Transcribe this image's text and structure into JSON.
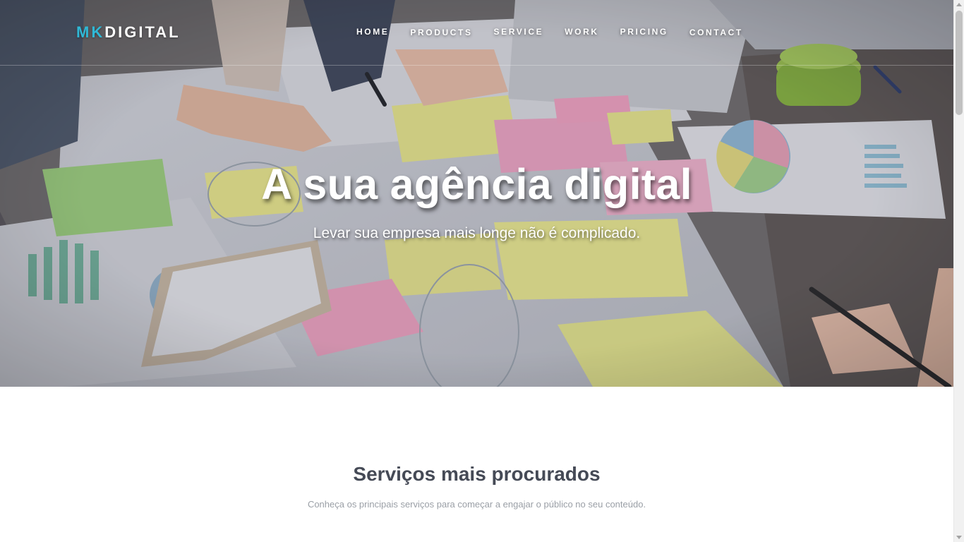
{
  "navbar": {
    "brand": {
      "accent": "MK",
      "main": "DIGITAL"
    },
    "items": [
      {
        "label": "HOME"
      },
      {
        "label": "PRODUCTS"
      },
      {
        "label": "SERVICE"
      },
      {
        "label": "WORK"
      },
      {
        "label": "PRICING"
      },
      {
        "label": "CONTACT"
      }
    ]
  },
  "hero": {
    "title": "A sua agência digital",
    "subtitle": "Levar sua empresa mais longe não é complicado."
  },
  "services": {
    "title": "Serviços mais procurados",
    "subtitle": "Conheça os principais serviços para começar a engajar o público no seu conteúdo."
  },
  "colors": {
    "brand_accent": "#2fb8d6",
    "heading": "#454a56",
    "muted_text": "#9a9fa6"
  }
}
